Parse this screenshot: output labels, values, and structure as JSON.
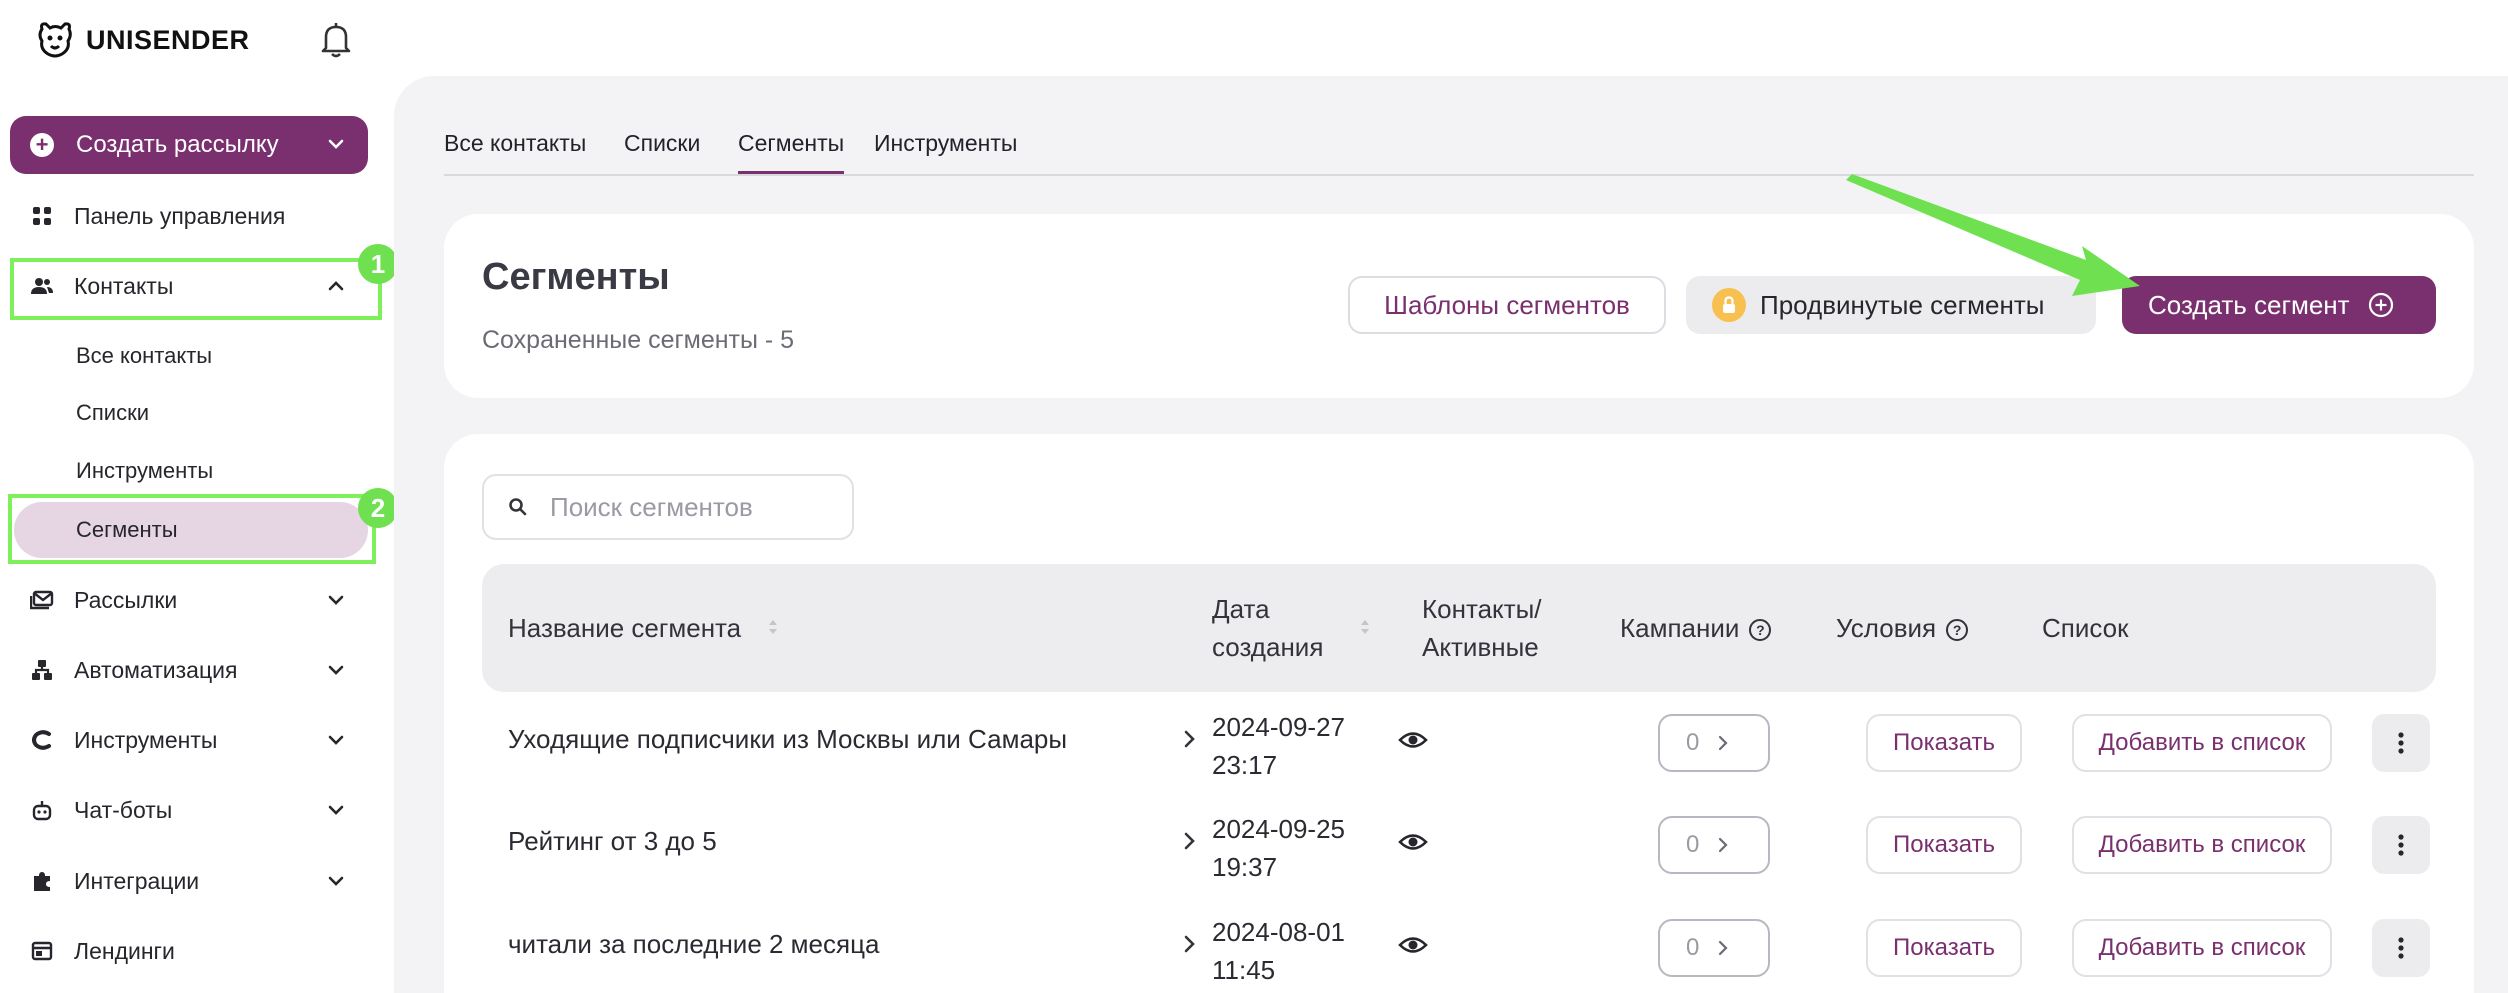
{
  "brand": {
    "name": "UNISENDER",
    "accent": "#7a2f6e",
    "highlight": "#7ef05c"
  },
  "sidebar": {
    "create_label": "Создать рассылку",
    "items": [
      {
        "label": "Панель управления",
        "icon": "dashboard-icon"
      },
      {
        "label": "Контакты",
        "icon": "contacts-icon",
        "expanded": true
      },
      {
        "label": "Рассылки",
        "icon": "mail-icon"
      },
      {
        "label": "Автоматизация",
        "icon": "automation-icon"
      },
      {
        "label": "Инструменты",
        "icon": "tools-icon"
      },
      {
        "label": "Чат-боты",
        "icon": "chatbot-icon"
      },
      {
        "label": "Интеграции",
        "icon": "puzzle-icon"
      },
      {
        "label": "Лендинги",
        "icon": "landing-icon"
      }
    ],
    "subitems": [
      "Все контакты",
      "Списки",
      "Инструменты",
      "Сегменты"
    ],
    "badges": [
      "1",
      "2"
    ]
  },
  "tabs": [
    "Все контакты",
    "Списки",
    "Сегменты",
    "Инструменты"
  ],
  "header": {
    "title": "Сегменты",
    "subtitle": "Сохраненные сегменты - 5",
    "templates_label": "Шаблоны сегментов",
    "advanced_label": "Продвинутые сегменты",
    "create_label": "Создать сегмент"
  },
  "search": {
    "placeholder": "Поиск сегментов"
  },
  "table": {
    "columns": {
      "name": "Название сегмента",
      "date_line1": "Дата",
      "date_line2": "создания",
      "contacts_line1": "Контакты/",
      "contacts_line2": "Активные",
      "campaigns": "Кампании",
      "conditions": "Условия",
      "list": "Список"
    },
    "rows": [
      {
        "name": "Уходящие подписчики из Москвы или Самары",
        "date": "2024-09-27",
        "time": "23:17",
        "campaigns": "0",
        "show": "Показать",
        "add": "Добавить в список"
      },
      {
        "name": "Рейтинг от 3 до 5",
        "date": "2024-09-25",
        "time": "19:37",
        "campaigns": "0",
        "show": "Показать",
        "add": "Добавить в список"
      },
      {
        "name": "читали за последние 2 месяца",
        "date": "2024-08-01",
        "time": "11:45",
        "campaigns": "0",
        "show": "Показать",
        "add": "Добавить в список"
      }
    ]
  }
}
